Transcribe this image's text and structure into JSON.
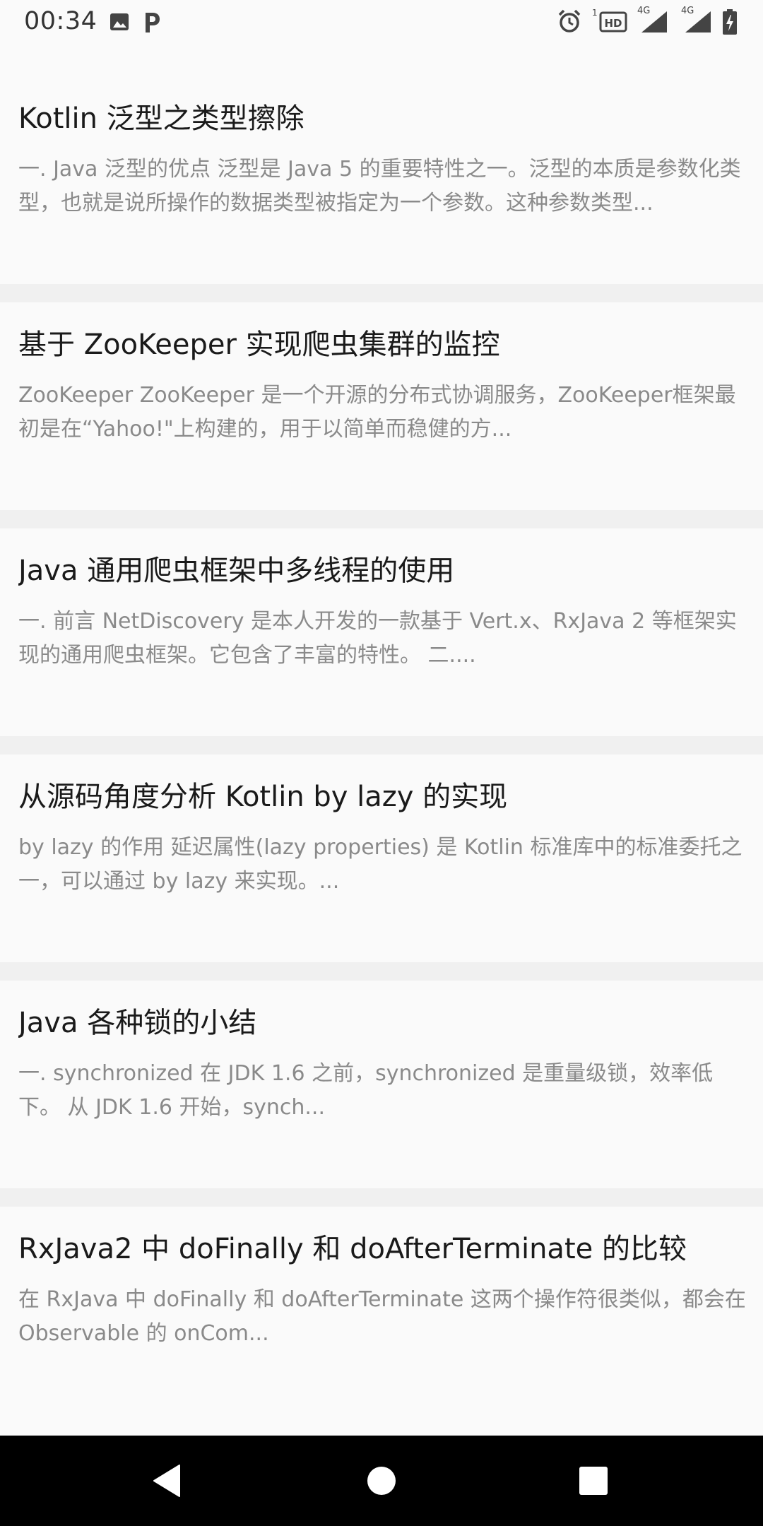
{
  "status_bar": {
    "time": "00:34",
    "icons": [
      "image-icon",
      "p-app-icon",
      "alarm-icon",
      "hd-icon",
      "signal-4g-icon",
      "signal-4g-icon-2",
      "battery-charging-icon"
    ],
    "hd_prefix": "1",
    "net_label_1": "4G",
    "net_label_2": "4G"
  },
  "articles": [
    {
      "title": "Kotlin 泛型之类型擦除",
      "summary": "一. Java 泛型的优点 泛型是 Java 5 的重要特性之一。泛型的本质是参数化类型，也就是说所操作的数据类型被指定为一个参数。这种参数类型..."
    },
    {
      "title": "基于 ZooKeeper 实现爬虫集群的监控",
      "summary": "ZooKeeper ZooKeeper 是一个开源的分布式协调服务，ZooKeeper框架最初是在“Yahoo!\"上构建的，用于以简单而稳健的方..."
    },
    {
      "title": "Java 通用爬虫框架中多线程的使用",
      "summary": "一. 前言 NetDiscovery 是本人开发的一款基于 Vert.x、RxJava 2 等框架实现的通用爬虫框架。它包含了丰富的特性。 二...."
    },
    {
      "title": "从源码角度分析 Kotlin by lazy 的实现",
      "summary": "by lazy 的作用 延迟属性(lazy properties) 是 Kotlin 标准库中的标准委托之一，可以通过 by lazy 来实现。..."
    },
    {
      "title": "Java 各种锁的小结",
      "summary": "一. synchronized 在 JDK 1.6 之前，synchronized 是重量级锁，效率低下。 从 JDK 1.6 开始，synch..."
    },
    {
      "title": "RxJava2 中 doFinally 和 doAfterTerminate 的比较",
      "summary": "在 RxJava 中 doFinally 和 doAfterTerminate 这两个操作符很类似，都会在 Observable 的 onCom..."
    }
  ],
  "nav_bar": {
    "buttons": [
      "back-icon",
      "home-icon",
      "recents-icon"
    ]
  },
  "colors": {
    "card_background": "#fafafa",
    "separator": "#f0f0f0",
    "title_text": "#1a1a1a",
    "summary_text": "#8a8a8a",
    "nav_background": "#000000"
  }
}
